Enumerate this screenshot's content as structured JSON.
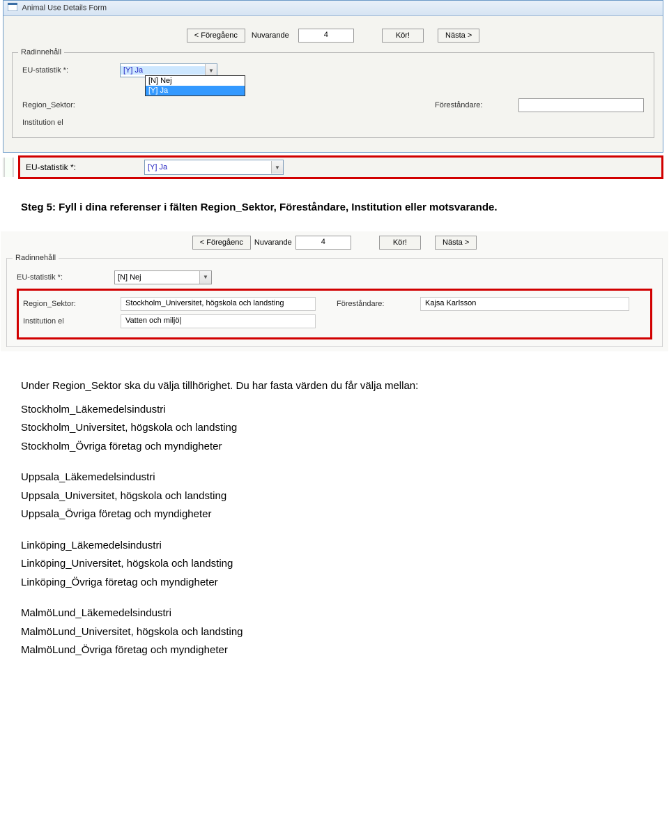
{
  "window": {
    "title": "Animal Use Details Form"
  },
  "nav": {
    "prev": "< Föregåenc",
    "current_label": "Nuvarande",
    "current_value": "4",
    "run": "Kör!",
    "next": "Nästa  >"
  },
  "fieldset1": {
    "legend": "Radinnehåll",
    "eu_label": "EU-statistik *:",
    "eu_value": "[Y] Ja",
    "eu_option_nej": "[N] Nej",
    "eu_option_ja": "[Y] Ja",
    "region_label": "Region_Sektor:",
    "forestandare_label": "Föreståndare:",
    "institution_label": "Institution el"
  },
  "highlight1": {
    "label": "EU-statistik *:",
    "value": "[Y] Ja"
  },
  "step5": {
    "heading": "Steg 5: Fyll i dina referenser i fälten Region_Sektor, Föreståndare, Institution eller motsvarande."
  },
  "panel2": {
    "legend": "Radinnehåll",
    "eu_label": "EU-statistik *:",
    "eu_value": "[N] Nej",
    "region_label": "Region_Sektor:",
    "region_value": "Stockholm_Universitet, högskola och landsting",
    "forestandare_label": "Föreståndare:",
    "forestandare_value": "Kajsa Karlsson",
    "institution_label": "Institution el",
    "institution_value": "Vatten och miljö|"
  },
  "doc": {
    "intro": "Under Region_Sektor ska du välja tillhörighet. Du har fasta värden du får välja mellan:",
    "groups": [
      [
        "Stockholm_Läkemedelsindustri",
        "Stockholm_Universitet, högskola och landsting",
        "Stockholm_Övriga företag och myndigheter"
      ],
      [
        "Uppsala_Läkemedelsindustri",
        "Uppsala_Universitet, högskola och landsting",
        "Uppsala_Övriga företag och myndigheter"
      ],
      [
        "Linköping_Läkemedelsindustri",
        "Linköping_Universitet, högskola och landsting",
        "Linköping_Övriga företag och myndigheter"
      ],
      [
        "MalmöLund_Läkemedelsindustri",
        "MalmöLund_Universitet, högskola och landsting",
        "MalmöLund_Övriga företag och myndigheter"
      ]
    ]
  }
}
